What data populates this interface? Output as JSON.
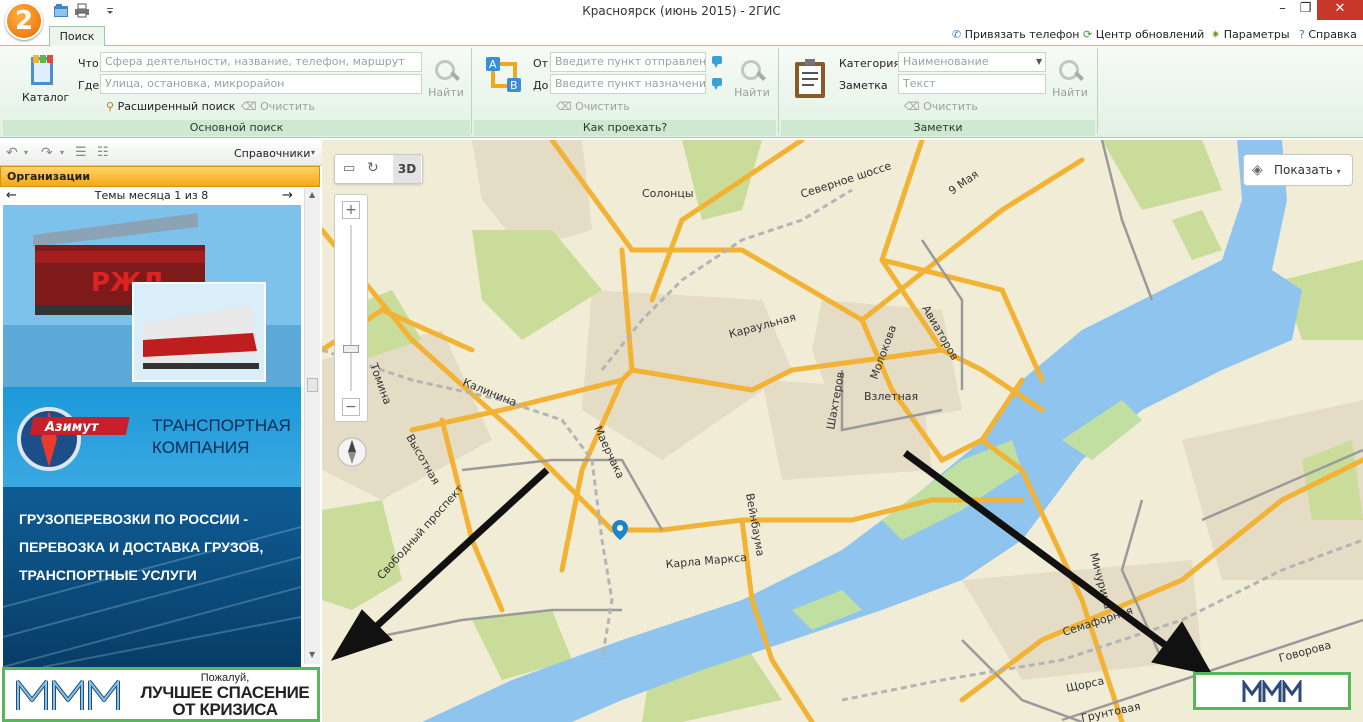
{
  "window": {
    "title": "Красноярск (июнь 2015) - 2ГИС",
    "logo_text": "2",
    "controls": {
      "minimize": "–",
      "maximize": "❐",
      "close": "✕"
    }
  },
  "tabs": [
    {
      "label": "Поиск",
      "active": true
    }
  ],
  "top_links": {
    "bind_phone": "Привязать телефон",
    "update_center": "Центр обновлений",
    "params": "Параметры",
    "help": "Справка"
  },
  "ribbon": {
    "main_search": {
      "group_title": "Основной поиск",
      "catalog_label": "Каталог",
      "what_label": "Что",
      "what_placeholder": "Сфера деятельности, название, телефон, маршрут",
      "where_label": "Где",
      "where_placeholder": "Улица, остановка, микрорайон",
      "advanced_label": "Расширенный поиск",
      "clear_label": "Очистить",
      "find_label": "Найти"
    },
    "route": {
      "group_title": "Как проехать?",
      "from_label": "От",
      "from_placeholder": "Введите пункт отправления",
      "to_label": "До",
      "to_placeholder": "Введите пункт назначения",
      "clear_label": "Очистить",
      "find_label": "Найти"
    },
    "notes": {
      "group_title": "Заметки",
      "category_label": "Категория",
      "category_placeholder": "Наименование",
      "note_label": "Заметка",
      "note_placeholder": "Текст",
      "clear_label": "Очистить",
      "find_label": "Найти"
    }
  },
  "left_panel": {
    "toolbar_dropdown": "Справочники",
    "section_title": "Организации",
    "themes_label": "Темы месяца 1 из 8",
    "ad": {
      "rzd_logo": "РЖД",
      "company_logo": "Азимут",
      "company_line1": "ТРАНСПОРТНАЯ",
      "company_line2": "КОМПАНИЯ",
      "text_lines": [
        "ГРУЗОПЕРЕВОЗКИ ПО РОССИИ -",
        "ПЕРЕВОЗКА И ДОСТАВКА ГРУЗОВ,",
        "ТРАНСПОРТНЫЕ УСЛУГИ"
      ]
    },
    "banner": {
      "line1": "Пожалуй,",
      "line2": "ЛУЧШЕЕ СПАСЕНИЕ",
      "line3": "ОТ КРИЗИСА"
    }
  },
  "map": {
    "mode_3d": "3D",
    "show_button": "Показать",
    "labels": {
      "solontsy": "Солонцы",
      "severnoe": "Северное шоссе",
      "may9": "9 Мая",
      "karaulnaya": "Караульная",
      "molokova": "Молокова",
      "aviatorov": "Авиаторов",
      "shakhterov": "Шахтеров",
      "vzletnaya": "Взлетная",
      "kalinina": "Калинина",
      "totmina": "Томина",
      "vysotnaya": "Высотная",
      "maerchaka": "Маерчака",
      "svobodny": "Свободный проспект",
      "veinbauma": "Вейнбаума",
      "karla_marksa": "Карла Маркса",
      "michurina": "Мичурина",
      "semafornaya": "Семафорная",
      "govorova": "Говорова",
      "shchorsa": "Щорса",
      "gruntovaya": "Грунтовая"
    }
  }
}
